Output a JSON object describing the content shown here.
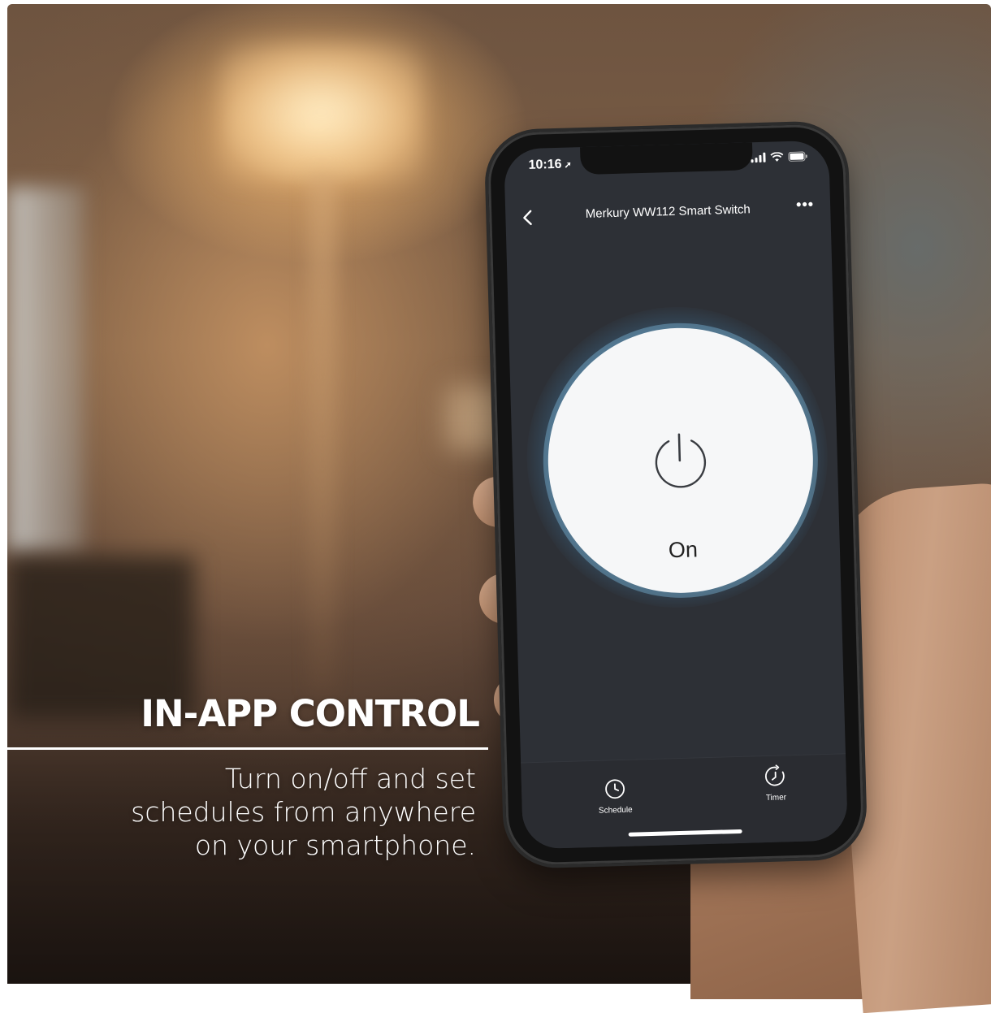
{
  "status_bar": {
    "time": "10:16",
    "location_arrow": "location-arrow-icon",
    "icons": [
      "cellular-signal-icon",
      "wifi-icon",
      "battery-icon"
    ]
  },
  "app": {
    "title": "Merkury WW112 Smart Switch",
    "back_icon": "chevron-left-icon",
    "more_label": "•••",
    "power": {
      "state": "On",
      "icon": "power-icon"
    },
    "tabs": [
      {
        "label": "Schedule",
        "icon": "clock-icon"
      },
      {
        "label": "Timer",
        "icon": "timer-icon"
      }
    ]
  },
  "caption": {
    "headline": "IN-APP CONTROL",
    "lines": [
      "Turn on/off and set",
      "schedules from anywhere",
      "on your smartphone."
    ]
  },
  "colors": {
    "screen_bg": "#2d3036",
    "glow": "#78bee9",
    "disc": "#f6f7f8"
  }
}
